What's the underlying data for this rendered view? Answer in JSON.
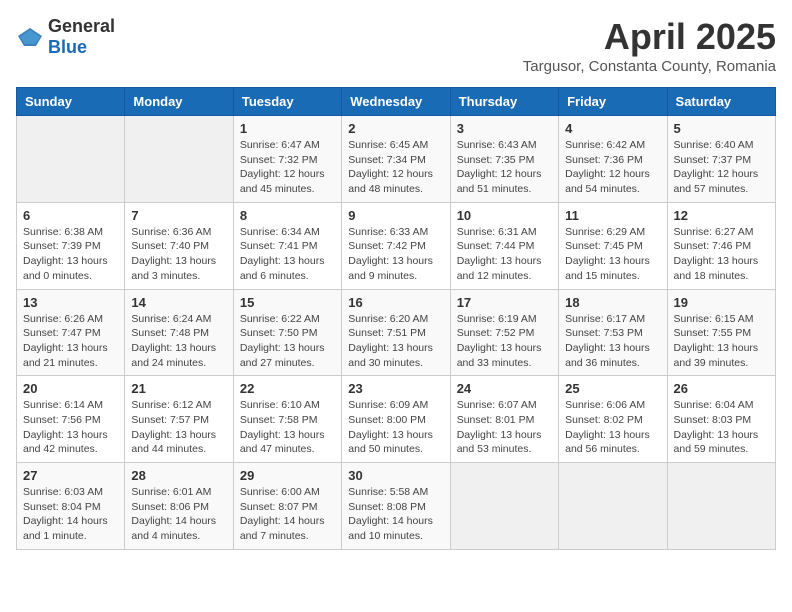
{
  "header": {
    "logo_general": "General",
    "logo_blue": "Blue",
    "month_title": "April 2025",
    "subtitle": "Targusor, Constanta County, Romania"
  },
  "weekdays": [
    "Sunday",
    "Monday",
    "Tuesday",
    "Wednesday",
    "Thursday",
    "Friday",
    "Saturday"
  ],
  "weeks": [
    [
      {
        "day": "",
        "sunrise": "",
        "sunset": "",
        "daylight": ""
      },
      {
        "day": "",
        "sunrise": "",
        "sunset": "",
        "daylight": ""
      },
      {
        "day": "1",
        "sunrise": "Sunrise: 6:47 AM",
        "sunset": "Sunset: 7:32 PM",
        "daylight": "Daylight: 12 hours and 45 minutes."
      },
      {
        "day": "2",
        "sunrise": "Sunrise: 6:45 AM",
        "sunset": "Sunset: 7:34 PM",
        "daylight": "Daylight: 12 hours and 48 minutes."
      },
      {
        "day": "3",
        "sunrise": "Sunrise: 6:43 AM",
        "sunset": "Sunset: 7:35 PM",
        "daylight": "Daylight: 12 hours and 51 minutes."
      },
      {
        "day": "4",
        "sunrise": "Sunrise: 6:42 AM",
        "sunset": "Sunset: 7:36 PM",
        "daylight": "Daylight: 12 hours and 54 minutes."
      },
      {
        "day": "5",
        "sunrise": "Sunrise: 6:40 AM",
        "sunset": "Sunset: 7:37 PM",
        "daylight": "Daylight: 12 hours and 57 minutes."
      }
    ],
    [
      {
        "day": "6",
        "sunrise": "Sunrise: 6:38 AM",
        "sunset": "Sunset: 7:39 PM",
        "daylight": "Daylight: 13 hours and 0 minutes."
      },
      {
        "day": "7",
        "sunrise": "Sunrise: 6:36 AM",
        "sunset": "Sunset: 7:40 PM",
        "daylight": "Daylight: 13 hours and 3 minutes."
      },
      {
        "day": "8",
        "sunrise": "Sunrise: 6:34 AM",
        "sunset": "Sunset: 7:41 PM",
        "daylight": "Daylight: 13 hours and 6 minutes."
      },
      {
        "day": "9",
        "sunrise": "Sunrise: 6:33 AM",
        "sunset": "Sunset: 7:42 PM",
        "daylight": "Daylight: 13 hours and 9 minutes."
      },
      {
        "day": "10",
        "sunrise": "Sunrise: 6:31 AM",
        "sunset": "Sunset: 7:44 PM",
        "daylight": "Daylight: 13 hours and 12 minutes."
      },
      {
        "day": "11",
        "sunrise": "Sunrise: 6:29 AM",
        "sunset": "Sunset: 7:45 PM",
        "daylight": "Daylight: 13 hours and 15 minutes."
      },
      {
        "day": "12",
        "sunrise": "Sunrise: 6:27 AM",
        "sunset": "Sunset: 7:46 PM",
        "daylight": "Daylight: 13 hours and 18 minutes."
      }
    ],
    [
      {
        "day": "13",
        "sunrise": "Sunrise: 6:26 AM",
        "sunset": "Sunset: 7:47 PM",
        "daylight": "Daylight: 13 hours and 21 minutes."
      },
      {
        "day": "14",
        "sunrise": "Sunrise: 6:24 AM",
        "sunset": "Sunset: 7:48 PM",
        "daylight": "Daylight: 13 hours and 24 minutes."
      },
      {
        "day": "15",
        "sunrise": "Sunrise: 6:22 AM",
        "sunset": "Sunset: 7:50 PM",
        "daylight": "Daylight: 13 hours and 27 minutes."
      },
      {
        "day": "16",
        "sunrise": "Sunrise: 6:20 AM",
        "sunset": "Sunset: 7:51 PM",
        "daylight": "Daylight: 13 hours and 30 minutes."
      },
      {
        "day": "17",
        "sunrise": "Sunrise: 6:19 AM",
        "sunset": "Sunset: 7:52 PM",
        "daylight": "Daylight: 13 hours and 33 minutes."
      },
      {
        "day": "18",
        "sunrise": "Sunrise: 6:17 AM",
        "sunset": "Sunset: 7:53 PM",
        "daylight": "Daylight: 13 hours and 36 minutes."
      },
      {
        "day": "19",
        "sunrise": "Sunrise: 6:15 AM",
        "sunset": "Sunset: 7:55 PM",
        "daylight": "Daylight: 13 hours and 39 minutes."
      }
    ],
    [
      {
        "day": "20",
        "sunrise": "Sunrise: 6:14 AM",
        "sunset": "Sunset: 7:56 PM",
        "daylight": "Daylight: 13 hours and 42 minutes."
      },
      {
        "day": "21",
        "sunrise": "Sunrise: 6:12 AM",
        "sunset": "Sunset: 7:57 PM",
        "daylight": "Daylight: 13 hours and 44 minutes."
      },
      {
        "day": "22",
        "sunrise": "Sunrise: 6:10 AM",
        "sunset": "Sunset: 7:58 PM",
        "daylight": "Daylight: 13 hours and 47 minutes."
      },
      {
        "day": "23",
        "sunrise": "Sunrise: 6:09 AM",
        "sunset": "Sunset: 8:00 PM",
        "daylight": "Daylight: 13 hours and 50 minutes."
      },
      {
        "day": "24",
        "sunrise": "Sunrise: 6:07 AM",
        "sunset": "Sunset: 8:01 PM",
        "daylight": "Daylight: 13 hours and 53 minutes."
      },
      {
        "day": "25",
        "sunrise": "Sunrise: 6:06 AM",
        "sunset": "Sunset: 8:02 PM",
        "daylight": "Daylight: 13 hours and 56 minutes."
      },
      {
        "day": "26",
        "sunrise": "Sunrise: 6:04 AM",
        "sunset": "Sunset: 8:03 PM",
        "daylight": "Daylight: 13 hours and 59 minutes."
      }
    ],
    [
      {
        "day": "27",
        "sunrise": "Sunrise: 6:03 AM",
        "sunset": "Sunset: 8:04 PM",
        "daylight": "Daylight: 14 hours and 1 minute."
      },
      {
        "day": "28",
        "sunrise": "Sunrise: 6:01 AM",
        "sunset": "Sunset: 8:06 PM",
        "daylight": "Daylight: 14 hours and 4 minutes."
      },
      {
        "day": "29",
        "sunrise": "Sunrise: 6:00 AM",
        "sunset": "Sunset: 8:07 PM",
        "daylight": "Daylight: 14 hours and 7 minutes."
      },
      {
        "day": "30",
        "sunrise": "Sunrise: 5:58 AM",
        "sunset": "Sunset: 8:08 PM",
        "daylight": "Daylight: 14 hours and 10 minutes."
      },
      {
        "day": "",
        "sunrise": "",
        "sunset": "",
        "daylight": ""
      },
      {
        "day": "",
        "sunrise": "",
        "sunset": "",
        "daylight": ""
      },
      {
        "day": "",
        "sunrise": "",
        "sunset": "",
        "daylight": ""
      }
    ]
  ]
}
